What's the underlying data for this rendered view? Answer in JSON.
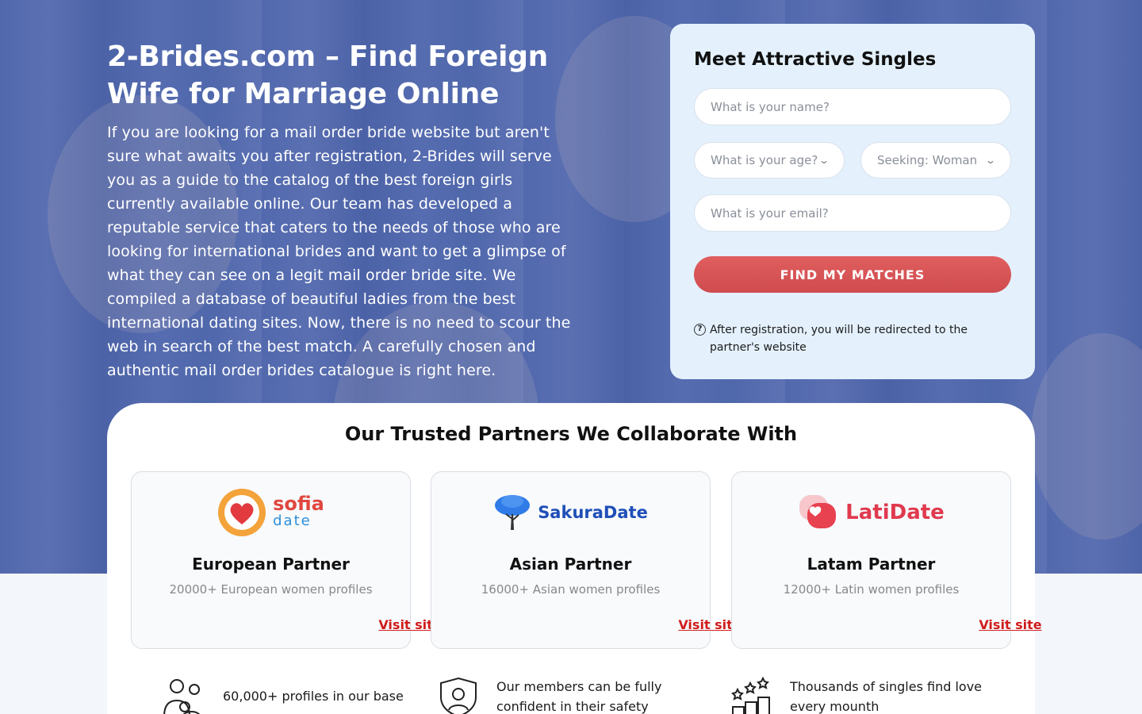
{
  "hero": {
    "title": "2-Brides.com – Find Foreign Wife for Marriage Online",
    "description": "If you are looking for a mail order bride website but aren't sure what awaits you after registration, 2-Brides will serve you as a guide to the catalog of the best foreign girls currently available online. Our team has developed a reputable service that caters to the needs of those who are looking for international brides and want to get a glimpse of what they can see on a legit mail order bride site. We compiled a database of beautiful ladies from the best international dating sites. Now, there is no need to scour the web in search of the best match. A carefully chosen and authentic mail order brides catalogue is right here."
  },
  "form": {
    "title": "Meet Attractive Singles",
    "name_placeholder": "What is your name?",
    "age_label": "What is your age?",
    "seeking_label": "Seeking: Woman",
    "email_placeholder": "What is your email?",
    "submit_label": "FIND MY MATCHES",
    "note_icon": "?",
    "note": "After registration, you will be redirected to the partner's website"
  },
  "partners": {
    "title": "Our Trusted Partners We Collaborate With",
    "cards": [
      {
        "logo_top": "sofia",
        "logo_bottom": "date",
        "title": "European Partner",
        "subtitle": "20000+ European women profiles",
        "link": "Visit site"
      },
      {
        "logo": "SakuraDate",
        "title": "Asian Partner",
        "subtitle": "16000+ Asian women profiles",
        "link": "Visit site"
      },
      {
        "logo": "LatiDate",
        "title": "Latam Partner",
        "subtitle": "12000+ Latin women profiles",
        "link": "Visit site"
      }
    ]
  },
  "features": [
    {
      "icon": "people-icon",
      "text": "60,000+ profiles in our base"
    },
    {
      "icon": "shield-user-icon",
      "text": "Our members can be fully confident in their safety"
    },
    {
      "icon": "stars-icon",
      "text": "Thousands of singles find love every mounth"
    }
  ],
  "colors": {
    "hero_overlay": "#4860aa",
    "form_bg": "#e4f1fd",
    "button": "#d9545a",
    "link": "#d01c1c",
    "sofia_orange": "#f0a23a",
    "sakura_blue": "#1e63d6",
    "lati_red": "#e03a4e"
  }
}
